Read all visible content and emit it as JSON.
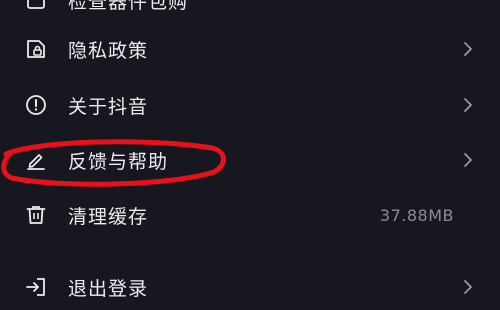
{
  "menu": {
    "top_partial": {
      "label": "检查器件包购",
      "icon": "box-icon"
    },
    "items": [
      {
        "label": "隐私政策",
        "icon": "lock-icon",
        "chevron": true
      },
      {
        "label": "关于抖音",
        "icon": "info-icon",
        "chevron": true
      },
      {
        "label": "反馈与帮助",
        "icon": "pencil-icon",
        "chevron": true
      },
      {
        "label": "清理缓存",
        "icon": "trash-icon",
        "value": "37.88MB"
      },
      {
        "label": "退出登录",
        "icon": "logout-icon",
        "chevron": true
      }
    ]
  },
  "colors": {
    "background": "#17171f",
    "text": "#ececf0",
    "muted": "#8c8c96",
    "annotation": "#e8101a"
  }
}
